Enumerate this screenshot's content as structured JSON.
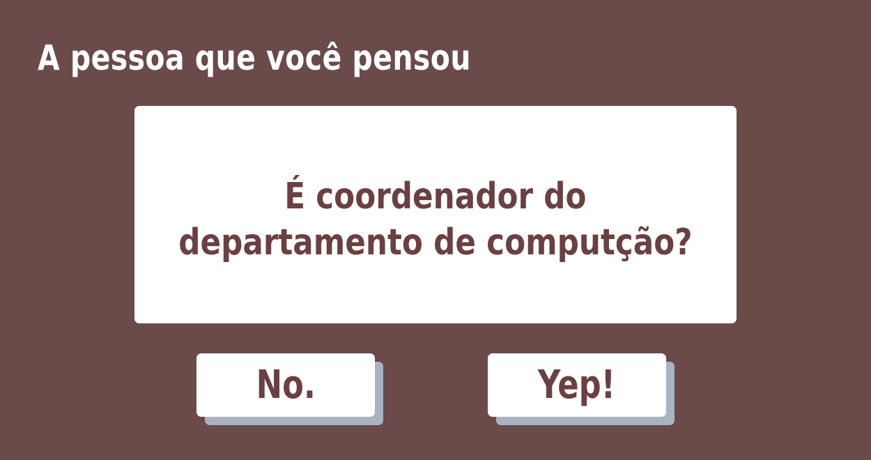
{
  "header": {
    "title": "A pessoa que você pensou"
  },
  "question": {
    "line1": "É coordenador do",
    "line2": "departamento de computção?"
  },
  "answers": {
    "no_label": "No.",
    "yes_label": "Yep!"
  },
  "colors": {
    "background": "#6b4a4a",
    "card": "#ffffff",
    "text": "#6b4040",
    "button_shadow": "#a9b4c2"
  }
}
